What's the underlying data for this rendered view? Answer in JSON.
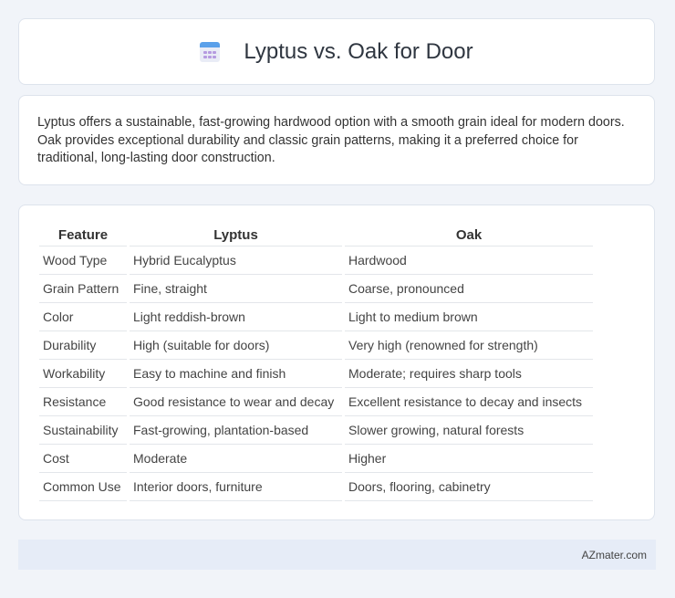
{
  "header": {
    "title": "Lyptus vs. Oak for Door",
    "icon": "calendar-icon"
  },
  "intro": {
    "text": "Lyptus offers a sustainable, fast-growing hardwood option with a smooth grain ideal for modern doors. Oak provides exceptional durability and classic grain patterns, making it a preferred choice for traditional, long-lasting door construction."
  },
  "table": {
    "columns": [
      "Feature",
      "Lyptus",
      "Oak"
    ],
    "rows": [
      [
        "Wood Type",
        "Hybrid Eucalyptus",
        "Hardwood"
      ],
      [
        "Grain Pattern",
        "Fine, straight",
        "Coarse, pronounced"
      ],
      [
        "Color",
        "Light reddish-brown",
        "Light to medium brown"
      ],
      [
        "Durability",
        "High (suitable for doors)",
        "Very high (renowned for strength)"
      ],
      [
        "Workability",
        "Easy to machine and finish",
        "Moderate; requires sharp tools"
      ],
      [
        "Resistance",
        "Good resistance to wear and decay",
        "Excellent resistance to decay and insects"
      ],
      [
        "Sustainability",
        "Fast-growing, plantation-based",
        "Slower growing, natural forests"
      ],
      [
        "Cost",
        "Moderate",
        "Higher"
      ],
      [
        "Common Use",
        "Interior doors, furniture",
        "Doors, flooring, cabinetry"
      ]
    ]
  },
  "footer": {
    "text": "AZmater.com"
  },
  "colors": {
    "background": "#f1f4f9",
    "card": "#ffffff",
    "footer_bg": "#e6ecf7",
    "icon_blue": "#5aa0ea",
    "icon_purple": "#b59be0"
  }
}
